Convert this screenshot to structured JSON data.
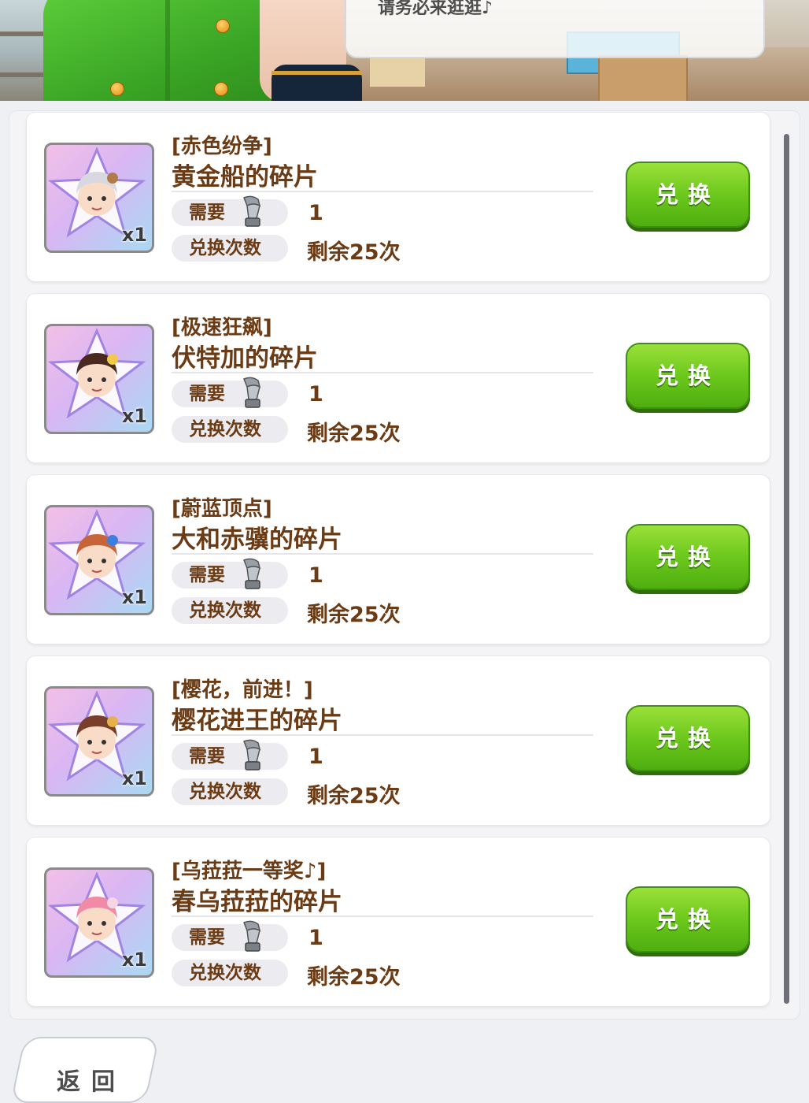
{
  "speech": {
    "text": "请务必来逛逛♪"
  },
  "exchange_button_label": "兑换",
  "labels": {
    "need": "需要",
    "exchange_count": "兑换次数"
  },
  "items": [
    {
      "title": "[赤色纷争]",
      "name": "黄金船的碎片",
      "card_qty": "x1",
      "need": "1",
      "remain": "剩余25次",
      "hair": "#d8d8e2",
      "accent": "#b07a4a"
    },
    {
      "title": "[极速狂飙]",
      "name": "伏特加的碎片",
      "card_qty": "x1",
      "need": "1",
      "remain": "剩余25次",
      "hair": "#4a2a20",
      "accent": "#f2c94c"
    },
    {
      "title": "[蔚蓝顶点]",
      "name": "大和赤骥的碎片",
      "card_qty": "x1",
      "need": "1",
      "remain": "剩余25次",
      "hair": "#c8643a",
      "accent": "#3d7ee0"
    },
    {
      "title": "[樱花，前进！]",
      "name": "樱花进王的碎片",
      "card_qty": "x1",
      "need": "1",
      "remain": "剩余25次",
      "hair": "#7a3f2a",
      "accent": "#e6b14a"
    },
    {
      "title": "[乌菈菈一等奖♪]",
      "name": "春乌菈菈的碎片",
      "card_qty": "x1",
      "need": "1",
      "remain": "剩余25次",
      "hair": "#f08aa6",
      "accent": "#f7d6e4"
    }
  ],
  "back_label": "返回",
  "colors": {
    "button_green": "#6cc81c",
    "text_brown": "#6a3b14"
  }
}
